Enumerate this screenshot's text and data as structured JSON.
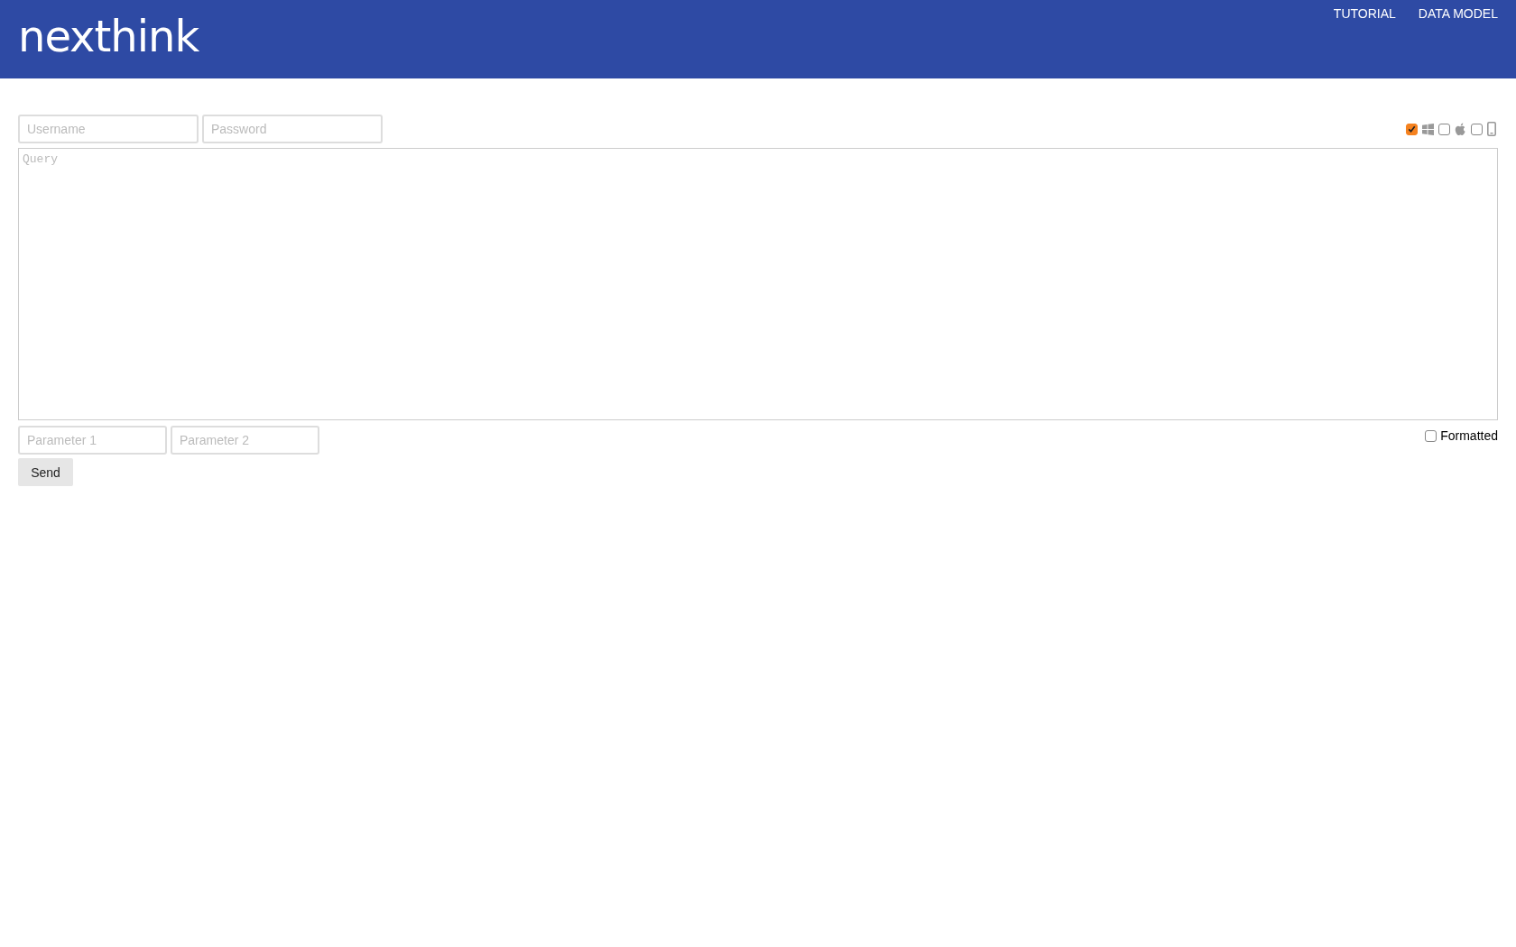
{
  "header": {
    "logo": "nexthink",
    "nav": [
      "TUTORIAL",
      "DATA MODEL"
    ]
  },
  "credentials": {
    "username_placeholder": "Username",
    "password_placeholder": "Password"
  },
  "platforms": [
    {
      "kind": "windows",
      "checked": true
    },
    {
      "kind": "apple",
      "checked": false
    },
    {
      "kind": "mobile",
      "checked": false
    }
  ],
  "query": {
    "placeholder": "Query"
  },
  "parameters": [
    {
      "placeholder": "Parameter 1"
    },
    {
      "placeholder": "Parameter 2"
    }
  ],
  "formatted": {
    "label": "Formatted",
    "checked": false
  },
  "send_button": "Send"
}
